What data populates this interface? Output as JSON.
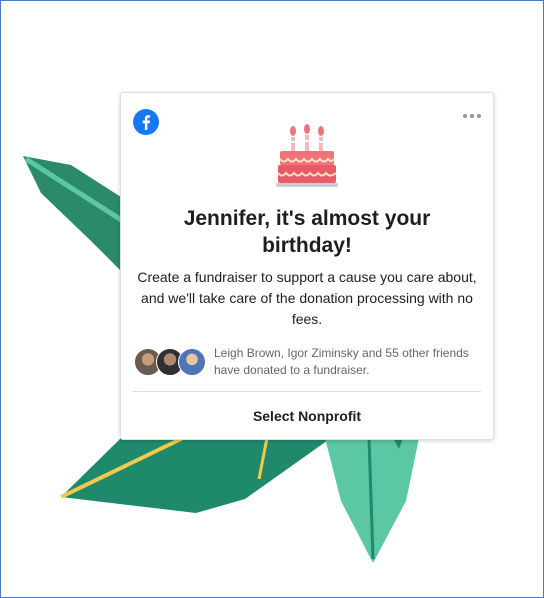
{
  "card": {
    "title": "Jennifer, it's almost your birthday!",
    "body": "Create a fundraiser to support a cause you care about, and we'll take care of the donation processing with no fees.",
    "friends_text": "Leigh Brown, Igor Ziminsky and 55 other friends have donated to a fundraiser.",
    "button_label": "Select Nonprofit"
  },
  "icons": {
    "logo": "facebook-logo-icon",
    "menu": "more-options-icon",
    "cake": "birthday-cake-icon"
  },
  "colors": {
    "frame_border": "#4a78c2",
    "facebook_blue": "#1877f2",
    "cake_pink": "#f0737a",
    "leaf_dark_green": "#1f8a6b",
    "leaf_light_green": "#5cc7a4",
    "leaf_stripe_yellow": "#f2c94c"
  }
}
